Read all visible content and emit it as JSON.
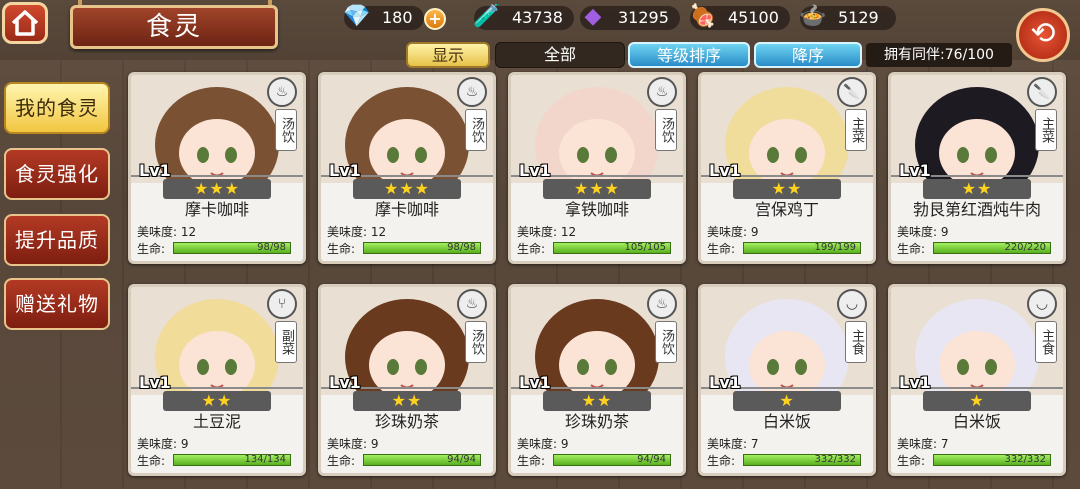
{
  "header": {
    "title": "食灵",
    "resources": [
      {
        "icon": "diamond-icon",
        "value": "180"
      },
      {
        "icon": "potion-icon",
        "value": "43738"
      },
      {
        "icon": "purple-crystal-icon",
        "value": "31295"
      },
      {
        "icon": "meat-icon",
        "value": "45100"
      },
      {
        "icon": "food-bowl-icon",
        "value": "5129"
      }
    ],
    "plus_label": "+",
    "back_label": "⟲"
  },
  "filters": {
    "show": "显示",
    "all": "全部",
    "level_sort": "等级排序",
    "order": "降序",
    "owned": "拥有同伴:76/100"
  },
  "sidebar": {
    "items": [
      {
        "label": "我的食灵",
        "active": true
      },
      {
        "label": "食灵强化",
        "active": false
      },
      {
        "label": "提升品质",
        "active": false
      },
      {
        "label": "赠送礼物",
        "active": false
      }
    ]
  },
  "cards": [
    {
      "name": "摩卡咖啡",
      "level": "Lv1",
      "stars": 3,
      "star_text": "★★★",
      "type": "汤饮",
      "type_icon": "soup-icon",
      "taste": "美味度: 12",
      "hp": "98/98",
      "hp_label": "生命:",
      "hair": "#7a5132"
    },
    {
      "name": "摩卡咖啡",
      "level": "Lv1",
      "stars": 3,
      "star_text": "★★★",
      "type": "汤饮",
      "type_icon": "soup-icon",
      "taste": "美味度: 12",
      "hp": "98/98",
      "hp_label": "生命:",
      "hair": "#7a5132"
    },
    {
      "name": "拿铁咖啡",
      "level": "Lv1",
      "stars": 3,
      "star_text": "★★★",
      "type": "汤饮",
      "type_icon": "soup-icon",
      "taste": "美味度: 12",
      "hp": "105/105",
      "hp_label": "生命:",
      "hair": "#f2d6cc"
    },
    {
      "name": "宫保鸡丁",
      "level": "Lv1",
      "stars": 2,
      "star_text": "★★",
      "type": "主菜",
      "type_icon": "knife-icon",
      "taste": "美味度: 9",
      "hp": "199/199",
      "hp_label": "生命:",
      "hair": "#f0dd9c"
    },
    {
      "name": "勃艮第红酒炖牛肉",
      "level": "Lv1",
      "stars": 2,
      "star_text": "★★",
      "type": "主菜",
      "type_icon": "knife-icon",
      "taste": "美味度: 9",
      "hp": "220/220",
      "hp_label": "生命:",
      "hair": "#1e1a22"
    },
    {
      "name": "土豆泥",
      "level": "Lv1",
      "stars": 2,
      "star_text": "★★",
      "type": "副菜",
      "type_icon": "fork-icon",
      "taste": "美味度: 9",
      "hp": "134/134",
      "hp_label": "生命:",
      "hair": "#f2dc9a"
    },
    {
      "name": "珍珠奶茶",
      "level": "Lv1",
      "stars": 2,
      "star_text": "★★",
      "type": "汤饮",
      "type_icon": "soup-icon",
      "taste": "美味度: 9",
      "hp": "94/94",
      "hp_label": "生命:",
      "hair": "#6a3a1e"
    },
    {
      "name": "珍珠奶茶",
      "level": "Lv1",
      "stars": 2,
      "star_text": "★★",
      "type": "汤饮",
      "type_icon": "soup-icon",
      "taste": "美味度: 9",
      "hp": "94/94",
      "hp_label": "生命:",
      "hair": "#6a3a1e"
    },
    {
      "name": "白米饭",
      "level": "Lv1",
      "stars": 1,
      "star_text": "★",
      "type": "主食",
      "type_icon": "rice-bowl-icon",
      "taste": "美味度: 7",
      "hp": "332/332",
      "hp_label": "生命:",
      "hair": "#e8e6f2"
    },
    {
      "name": "白米饭",
      "level": "Lv1",
      "stars": 1,
      "star_text": "★",
      "type": "主食",
      "type_icon": "rice-bowl-icon",
      "taste": "美味度: 7",
      "hp": "332/332",
      "hp_label": "生命:",
      "hair": "#e8e6f2"
    }
  ]
}
